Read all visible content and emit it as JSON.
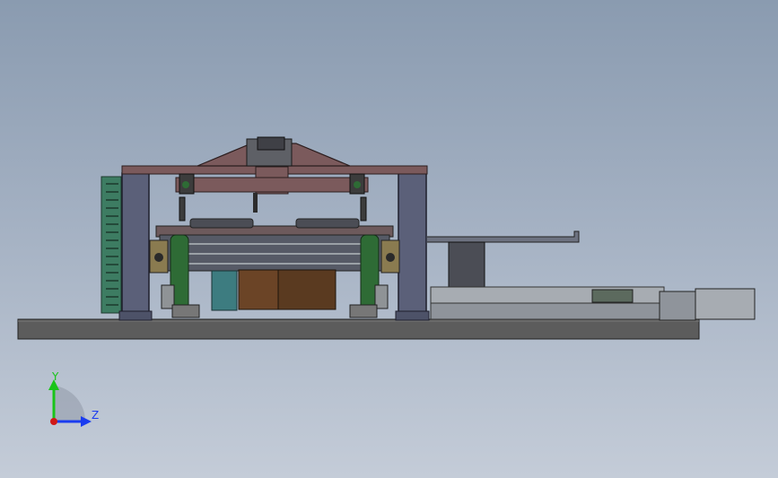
{
  "viewport": {
    "background_top": "#8a9bb0",
    "background_bottom": "#c4ccd8"
  },
  "triad": {
    "y_label": "Y",
    "z_label": "Z",
    "y_color": "#19c419",
    "z_color": "#1a3cf0",
    "origin_color": "#d01818"
  },
  "palette": {
    "frame": "#7b5a5a",
    "column": "#5a5f78",
    "base": "#585858",
    "roller_green": "#2e6b35",
    "teal": "#3d7c80",
    "motor_brown": "#5a3a20",
    "rail": "#9aa0a6",
    "dark": "#2a2a2a"
  }
}
